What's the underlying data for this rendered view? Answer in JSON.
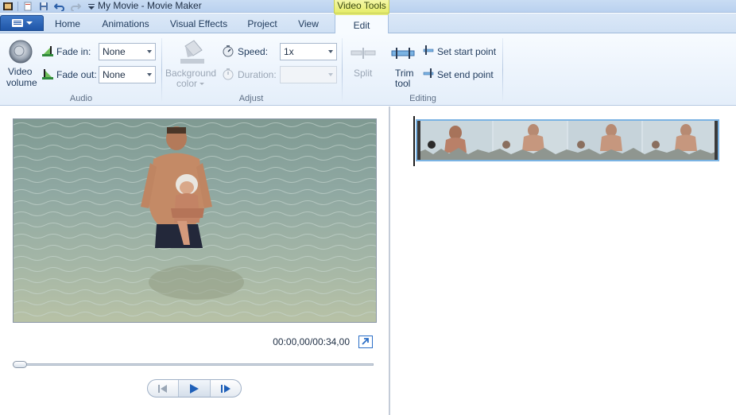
{
  "window": {
    "title": "My Movie - Movie Maker",
    "contextual_tab_group": "Video Tools"
  },
  "tabs": [
    {
      "label": "Home"
    },
    {
      "label": "Animations"
    },
    {
      "label": "Visual Effects"
    },
    {
      "label": "Project"
    },
    {
      "label": "View"
    },
    {
      "label": "Edit",
      "active": true
    }
  ],
  "ribbon": {
    "audio": {
      "group_label": "Audio",
      "video_volume_label_line1": "Video",
      "video_volume_label_line2": "volume",
      "fade_in_label": "Fade in:",
      "fade_in_value": "None",
      "fade_out_label": "Fade out:",
      "fade_out_value": "None"
    },
    "adjust": {
      "group_label": "Adjust",
      "background_color_line1": "Background",
      "background_color_line2": "color",
      "speed_label": "Speed:",
      "speed_value": "1x",
      "duration_label": "Duration:",
      "duration_value": ""
    },
    "editing": {
      "group_label": "Editing",
      "split_label": "Split",
      "trim_tool_line1": "Trim",
      "trim_tool_line2": "tool",
      "set_start_point": "Set start point",
      "set_end_point": "Set end point"
    }
  },
  "preview": {
    "time_display": "00:00,00/00:34,00",
    "seek_position": 0.0
  },
  "colors": {
    "accent": "#2b6fc7",
    "contextual_tab": "#e6ed6a",
    "clip_border": "#7ab3e3"
  },
  "icons": [
    "menu-icon",
    "save-icon",
    "undo-icon",
    "redo-icon",
    "speaker-icon",
    "fade-in-icon",
    "fade-out-icon",
    "paint-bucket-icon",
    "speed-icon",
    "duration-icon",
    "split-icon",
    "trim-icon",
    "set-start-icon",
    "set-end-icon",
    "fullscreen-icon",
    "previous-frame-icon",
    "play-icon",
    "next-frame-icon"
  ]
}
